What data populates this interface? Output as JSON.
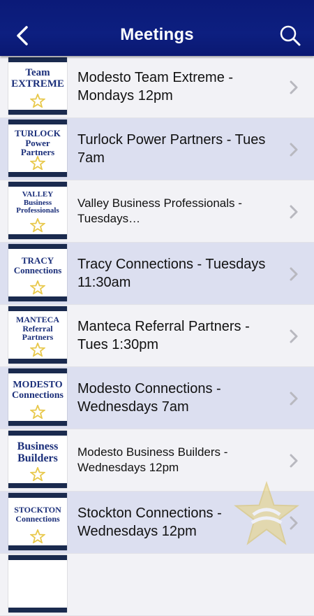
{
  "header": {
    "title": "Meetings",
    "back_icon": "chevron-left-icon",
    "search_icon": "search-icon"
  },
  "colors": {
    "header": "#0d1f80",
    "row_light": "#f2f2f6",
    "row_tint": "#dcdff0",
    "logo_text": "#1b2f7a",
    "logo_star": "#e8c84a"
  },
  "meetings": [
    {
      "logo": "Team EXTREME",
      "label": "Modesto Team Extreme - Mondays 12pm"
    },
    {
      "logo": "TURLOCK Power Partners",
      "label": "Turlock Power Partners - Tues 7am"
    },
    {
      "logo": "VALLEY Business Professionals",
      "label": "Valley Business Professionals - Tuesdays…"
    },
    {
      "logo": "TRACY Connections",
      "label": "Tracy Connections - Tuesdays 11:30am"
    },
    {
      "logo": "MANTECA Referral Partners",
      "label": "Manteca Referral Partners - Tues 1:30pm"
    },
    {
      "logo": "MODESTO Connections",
      "label": "Modesto Connections - Wednesdays 7am"
    },
    {
      "logo": "Business Builders",
      "label": "Modesto Business Builders - Wednesdays 12pm"
    },
    {
      "logo": "STOCKTON Connections",
      "label": "Stockton Connections - Wednesdays 12pm"
    }
  ]
}
